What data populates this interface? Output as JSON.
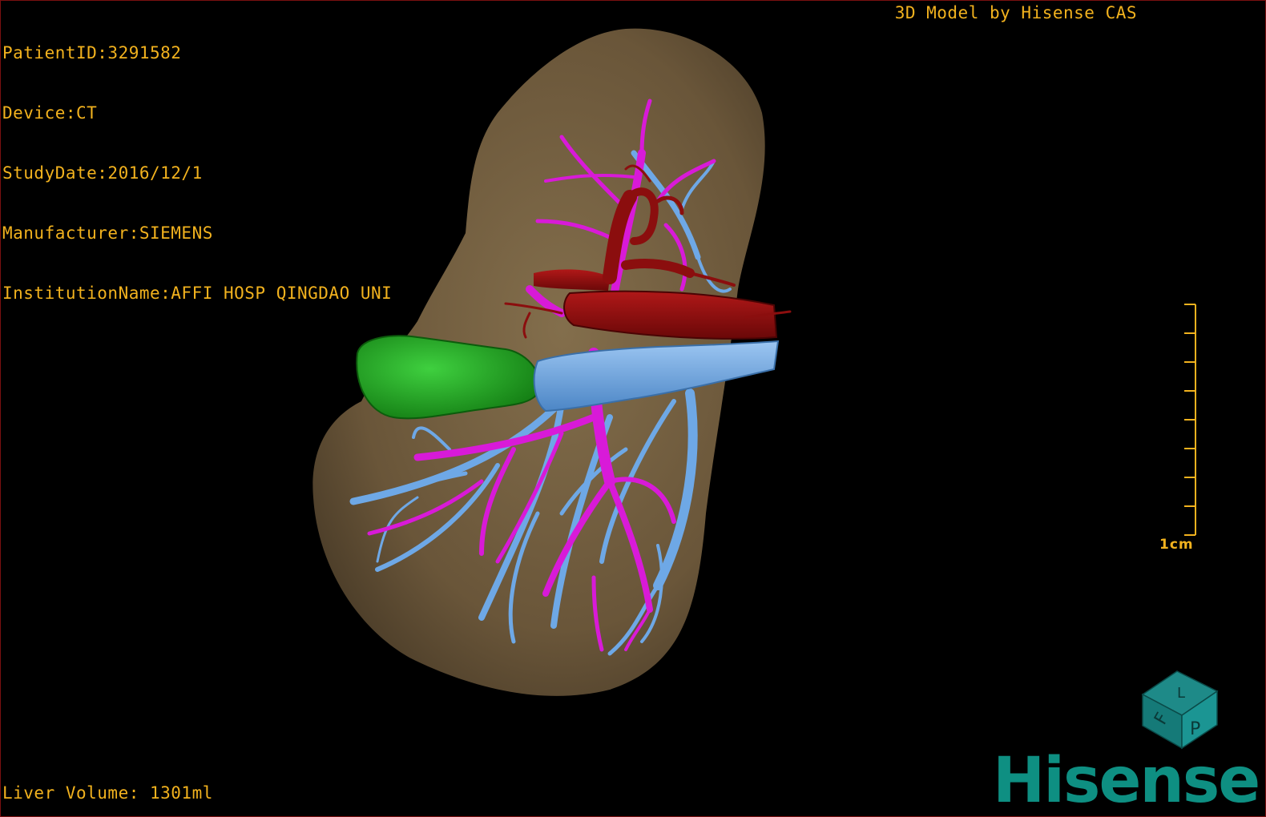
{
  "app": {
    "credit": "3D Model by Hisense CAS",
    "brand": "Hisense"
  },
  "study_info": [
    "PatientID:3291582",
    "Device:CT",
    "StudyDate:2016/12/1",
    "Manufacturer:SIEMENS",
    "InstitutionName:AFFI HOSP QINGDAO UNI"
  ],
  "measurements": {
    "liver_volume": "Liver Volume: 1301ml"
  },
  "scale_bar": {
    "label": "1cm",
    "tick_count": 9
  },
  "orientation_cube": {
    "face_left": "F",
    "face_right": "P",
    "face_top": "L"
  },
  "colors": {
    "overlay_text": "#f2b21e",
    "liver": "#7b6444",
    "hepatic_artery": "#8b0e0e",
    "portal_vein": "#d81ad8",
    "hepatic_vein": "#6ea8e6",
    "gallbladder": "#1fa31f",
    "brand": "#0e8f82"
  },
  "structures": [
    "liver",
    "gallbladder",
    "hepatic-artery",
    "portal-vein",
    "hepatic-vein",
    "inferior-vena-cava"
  ]
}
